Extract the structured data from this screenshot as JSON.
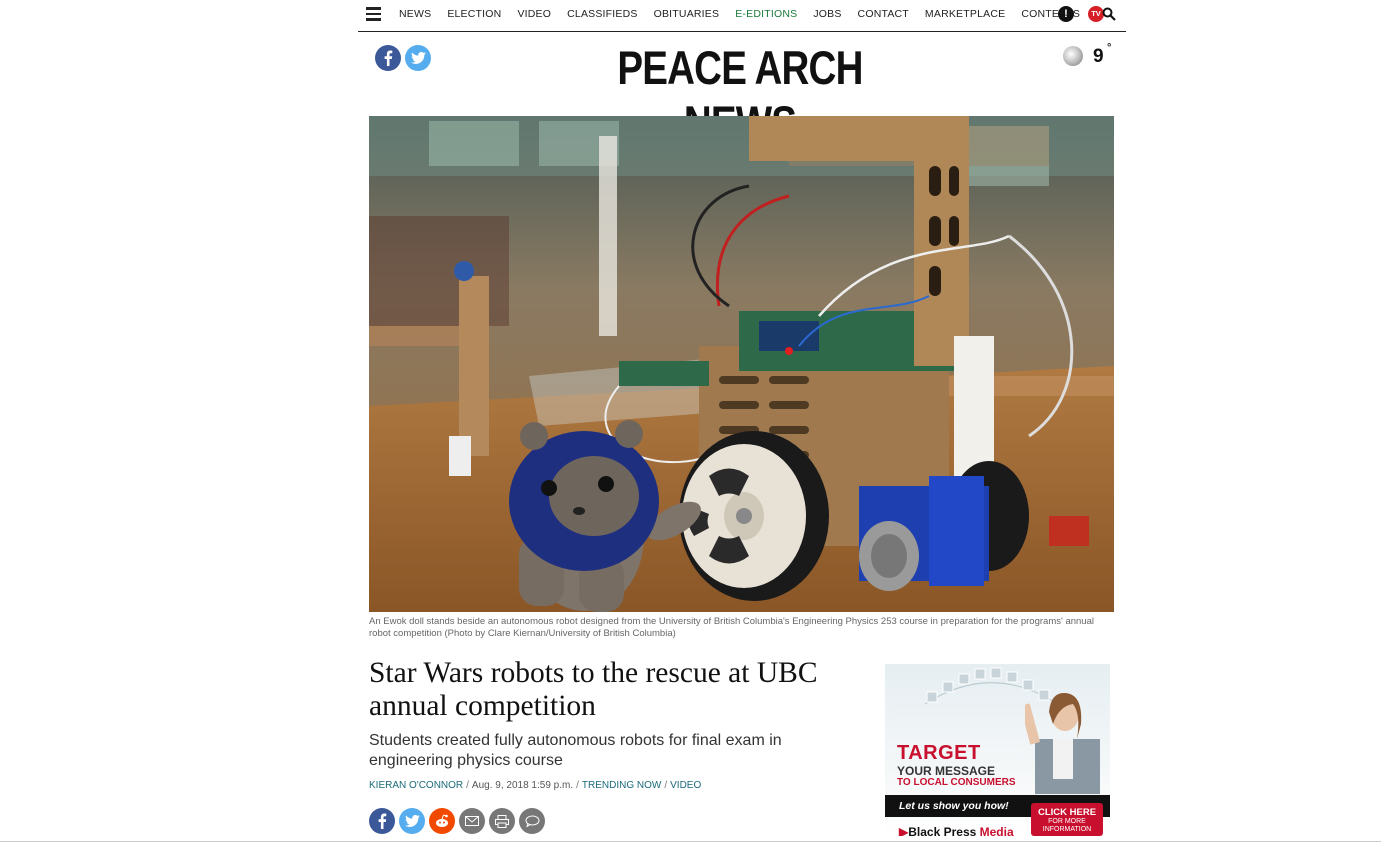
{
  "nav": {
    "links": [
      "NEWS",
      "ELECTION",
      "VIDEO",
      "CLASSIFIEDS",
      "OBITUARIES",
      "E-EDITIONS",
      "JOBS",
      "CONTACT",
      "MARKETPLACE",
      "CONTESTS"
    ],
    "alert_glyph": "!",
    "tv_label": "TV",
    "highlight_color": "#1b7a3a"
  },
  "masthead": {
    "logo": "PEACE ARCH NEWS",
    "weather": {
      "temp": "9",
      "unit": "°",
      "icon": "moon-icon"
    }
  },
  "hero": {
    "caption": "An Ewok doll stands beside an autonomous robot designed from the University of British Columbia's Engineering Physics 253 course in preparation for the programs' annual robot competition (Photo by Clare Kiernan/University of British Columbia)"
  },
  "article": {
    "headline": "Star Wars robots to the rescue at UBC annual competition",
    "dek": "Students created fully autonomous robots for final exam in engineering physics course",
    "author": "KIERAN O'CONNOR",
    "date": "Aug. 9, 2018 1:59 p.m.",
    "tags": [
      "TRENDING NOW",
      "VIDEO"
    ],
    "share_icons": [
      "facebook-icon",
      "twitter-icon",
      "reddit-icon",
      "email-icon",
      "print-icon",
      "comment-icon"
    ]
  },
  "ad": {
    "headline": "TARGET",
    "line1": "YOUR MESSAGE",
    "line2": "TO LOCAL CONSUMERS",
    "tagline": "Let us show you how!",
    "cta_main": "CLICK HERE",
    "cta_sub1": "FOR MORE",
    "cta_sub2": "INFORMATION",
    "brand_a": "Black Press",
    "brand_b": "Media",
    "accent": "#c8102e"
  }
}
